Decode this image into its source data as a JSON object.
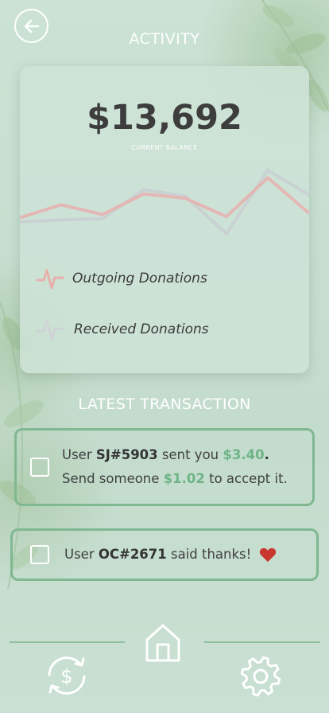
{
  "header": {
    "title": "ACTIVITY",
    "back_icon": "arrow-left-icon"
  },
  "balance": {
    "amount": "$13,692",
    "label": "CURRENT BALANCE"
  },
  "chart_data": {
    "type": "line",
    "x": [
      0,
      1,
      2,
      3,
      4,
      5,
      6,
      7
    ],
    "series": [
      {
        "name": "Outgoing Donations",
        "color": "#e6b3b0",
        "values": [
          1.8,
          3.0,
          2.1,
          4.0,
          3.6,
          1.9,
          5.5,
          2.2
        ]
      },
      {
        "name": "Received Donations",
        "color": "#c9cfd2",
        "values": [
          1.4,
          1.6,
          1.7,
          4.4,
          3.8,
          0.3,
          6.2,
          3.9
        ]
      }
    ],
    "ylim": [
      0,
      7
    ],
    "grid": false,
    "legend_position": "below"
  },
  "legend": {
    "outgoing_label": "Outgoing Donations",
    "received_label": "Received Donations"
  },
  "transactions": {
    "section_title": "LATEST TRANSACTION",
    "items": [
      {
        "prefix": "User ",
        "user": "SJ#5903",
        "middle": " sent you ",
        "amount": "$3.40",
        "suffix": ".",
        "line2_prefix": "Send someone ",
        "line2_amount": "$1.02",
        "line2_suffix": " to accept it."
      },
      {
        "prefix": "User ",
        "user": "OC#2671",
        "suffix": " said thanks!",
        "icon": "heart-icon"
      }
    ]
  },
  "colors": {
    "accent_green": "#6db486",
    "border_green": "#7fb891",
    "heart_red": "#c8372d"
  },
  "nav": {
    "items": [
      "exchange-icon",
      "home-icon",
      "settings-icon"
    ]
  }
}
